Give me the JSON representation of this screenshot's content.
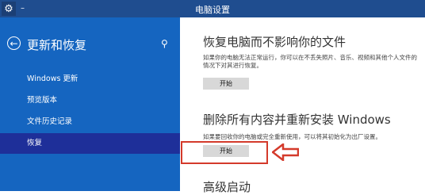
{
  "window": {
    "title": "电脑设置",
    "separator": "–",
    "settings_icon": "gear-icon"
  },
  "sidebar": {
    "back_icon": "back-arrow-icon",
    "heading": "更新和恢复",
    "search_icon": "search-icon",
    "items": [
      {
        "label": "Windows 更新",
        "active": false
      },
      {
        "label": "预览版本",
        "active": false
      },
      {
        "label": "文件历史记录",
        "active": false
      },
      {
        "label": "恢复",
        "active": true
      }
    ]
  },
  "main": {
    "sections": [
      {
        "title": "恢复电脑而不影响你的文件",
        "description": "如果你的电脑无法正常运行，你可以在不丢失照片、音乐、视频和其他个人文件的情况下对其进行恢复。",
        "button_label": "开始"
      },
      {
        "title": "删除所有内容并重新安装 Windows",
        "description": "如果要回收你的电脑或完全重新使用，可以将其初始化为出厂设置。",
        "button_label": "开始"
      },
      {
        "title": "高级启动"
      }
    ]
  },
  "annotation": {
    "highlight_color": "#d43a2b"
  }
}
